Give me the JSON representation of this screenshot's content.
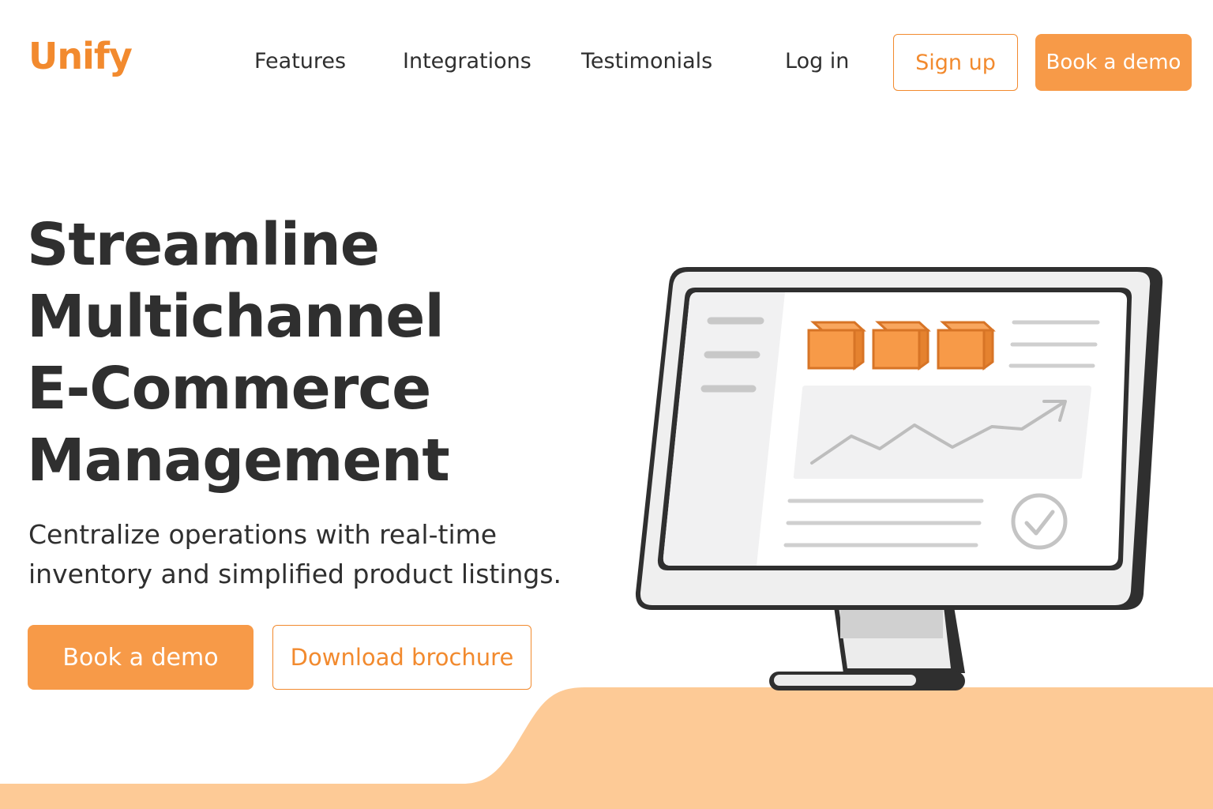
{
  "brand": {
    "name": "Unify",
    "accent": "#f28a2e",
    "button_fill": "#f79a48",
    "footer_wave": "#fdca96"
  },
  "nav": {
    "links": [
      {
        "label": "Features"
      },
      {
        "label": "Integrations"
      },
      {
        "label": "Testimonials"
      }
    ],
    "login": "Log in",
    "signup": "Sign up",
    "demo": "Book a demo"
  },
  "hero": {
    "title_lines": [
      "Streamline",
      "Multichannel",
      "E-Commerce",
      "Management"
    ],
    "subtitle_lines": [
      "Centralize operations with real-time",
      "inventory and simplified product listings."
    ],
    "primary_cta": "Book a demo",
    "secondary_cta": "Download brochure"
  },
  "illustration": {
    "subject": "desktop-monitor",
    "icons": [
      "box-icon",
      "box-icon",
      "box-icon",
      "trend-arrow-icon",
      "check-circle-icon"
    ]
  }
}
